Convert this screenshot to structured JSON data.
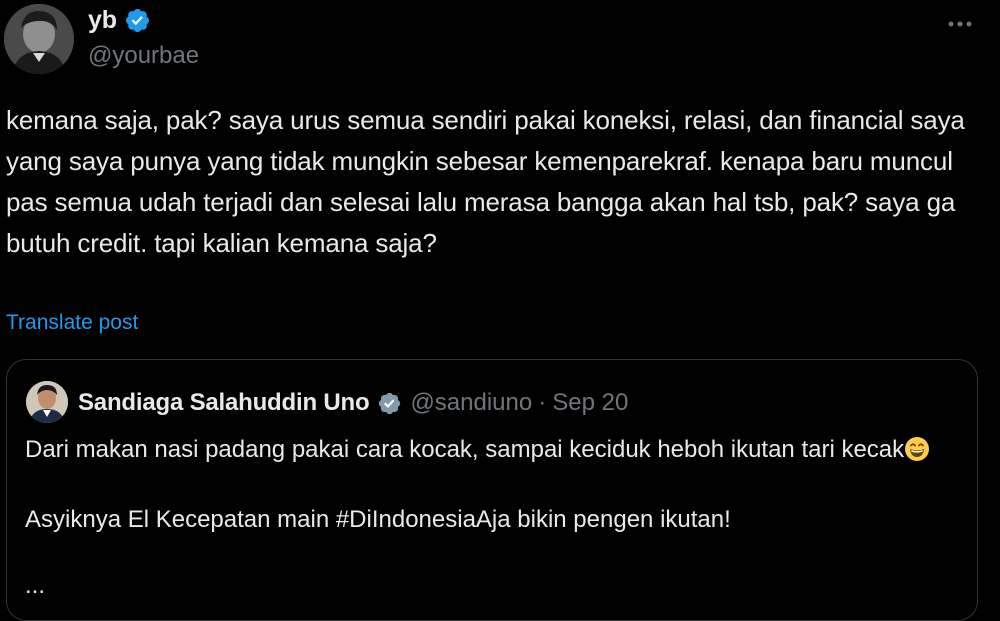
{
  "author": {
    "name": "yb",
    "handle": "@yourbae",
    "verified": true
  },
  "icons": {
    "more": "more-horizontal-icon",
    "verified": "verified-badge-icon",
    "emoji": "grinning-face-emoji"
  },
  "colors": {
    "background": "#000000",
    "text": "#e7e9ea",
    "secondary_text": "#71767b",
    "link": "#1d9bf0",
    "verified_badge": "#1d9bf0",
    "quote_verified_badge": "#829aab",
    "border": "#2f3336"
  },
  "tweet": {
    "text": "kemana saja, pak? saya urus semua sendiri pakai koneksi, relasi, dan financial saya yang saya punya yang tidak mungkin sebesar kemenparekraf. kenapa baru muncul pas semua udah terjadi dan selesai lalu merasa bangga akan hal tsb, pak? saya ga butuh credit. tapi kalian kemana saja?",
    "translate_label": "Translate post"
  },
  "quote": {
    "name": "Sandiaga Salahuddin Uno",
    "handle": "@sandiuno",
    "separator": "·",
    "date": "Sep 20",
    "line1": "Dari makan nasi padang pakai cara kocak, sampai keciduk heboh ikutan tari kecak",
    "line2": "Asyiknya El Kecepatan main #DiIndonesiaAja bikin pengen ikutan!",
    "more": "..."
  }
}
